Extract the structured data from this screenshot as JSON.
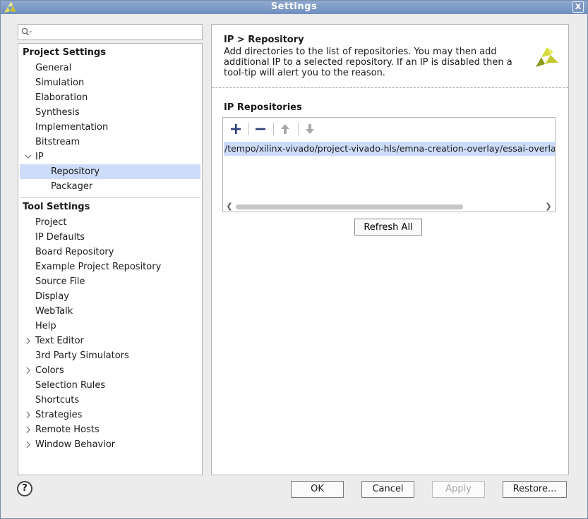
{
  "window": {
    "title": "Settings",
    "close_glyph": "X"
  },
  "search": {
    "value": "",
    "placeholder": ""
  },
  "tree": {
    "project_settings_label": "Project Settings",
    "project_items": [
      {
        "label": "General"
      },
      {
        "label": "Simulation"
      },
      {
        "label": "Elaboration"
      },
      {
        "label": "Synthesis"
      },
      {
        "label": "Implementation"
      },
      {
        "label": "Bitstream"
      },
      {
        "label": "IP"
      },
      {
        "label": "Repository"
      },
      {
        "label": "Packager"
      }
    ],
    "tool_settings_label": "Tool Settings",
    "tool_items": [
      {
        "label": "Project"
      },
      {
        "label": "IP Defaults"
      },
      {
        "label": "Board Repository"
      },
      {
        "label": "Example Project Repository"
      },
      {
        "label": "Source File"
      },
      {
        "label": "Display"
      },
      {
        "label": "WebTalk"
      },
      {
        "label": "Help"
      },
      {
        "label": "Text Editor"
      },
      {
        "label": "3rd Party Simulators"
      },
      {
        "label": "Colors"
      },
      {
        "label": "Selection Rules"
      },
      {
        "label": "Shortcuts"
      },
      {
        "label": "Strategies"
      },
      {
        "label": "Remote Hosts"
      },
      {
        "label": "Window Behavior"
      }
    ]
  },
  "content": {
    "breadcrumb": "IP > Repository",
    "description": "Add directories to the list of repositories. You may then add additional IP to a selected repository. If an IP is disabled then a tool-tip will alert you to the reason.",
    "section_title": "IP Repositories",
    "repositories": [
      "/tempo/xilinx-vivado/project-vivado-hls/emna-creation-overlay/essai-overlay/"
    ],
    "refresh_label": "Refresh All",
    "toolbar_icons": [
      "add-icon",
      "remove-icon",
      "move-up-icon",
      "move-down-icon"
    ]
  },
  "footer": {
    "help_label": "?",
    "ok_label": "OK",
    "cancel_label": "Cancel",
    "apply_label": "Apply",
    "restore_label": "Restore..."
  },
  "colors": {
    "selection": "#cddcf9",
    "titlebar": "#7f9cc8",
    "logo_yellow": "#d4dc3c",
    "logo_olive": "#8c9a1e"
  }
}
